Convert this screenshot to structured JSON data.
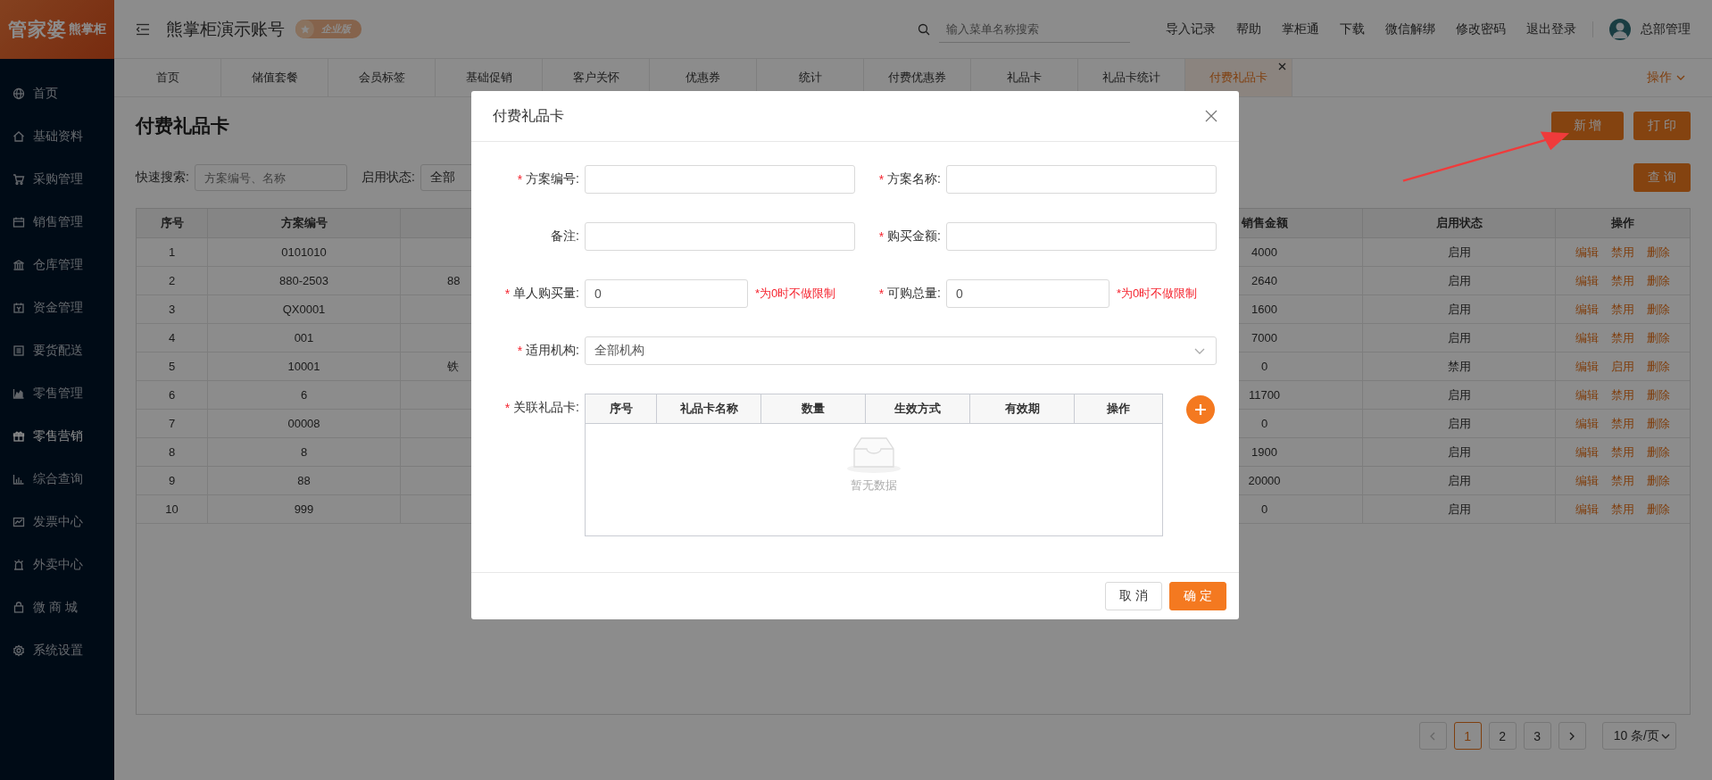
{
  "sidebar": {
    "logo": {
      "main": "管家婆",
      "sub": "熊掌柜"
    },
    "items": [
      {
        "label": "首页",
        "selected": false
      },
      {
        "label": "基础资料",
        "selected": false
      },
      {
        "label": "采购管理",
        "selected": false
      },
      {
        "label": "销售管理",
        "selected": false
      },
      {
        "label": "仓库管理",
        "selected": false
      },
      {
        "label": "资金管理",
        "selected": false
      },
      {
        "label": "要货配送",
        "selected": false
      },
      {
        "label": "零售管理",
        "selected": false
      },
      {
        "label": "零售营销",
        "selected": true
      },
      {
        "label": "综合查询",
        "selected": false
      },
      {
        "label": "发票中心",
        "selected": false
      },
      {
        "label": "外卖中心",
        "selected": false
      },
      {
        "label": "微 商 城",
        "selected": false
      },
      {
        "label": "系统设置",
        "selected": false
      }
    ]
  },
  "topbar": {
    "account": "熊掌柜演示账号",
    "badge": "企业版",
    "search": {
      "placeholder": "输入菜单名称搜索"
    },
    "links": [
      "导入记录",
      "帮助",
      "掌柜通",
      "下载",
      "微信解绑",
      "修改密码",
      "退出登录"
    ],
    "user": "总部管理"
  },
  "tabs": {
    "items": [
      {
        "label": "首页",
        "selected": false
      },
      {
        "label": "储值套餐",
        "selected": false
      },
      {
        "label": "会员标签",
        "selected": false
      },
      {
        "label": "基础促销",
        "selected": false
      },
      {
        "label": "客户关怀",
        "selected": false
      },
      {
        "label": "优惠券",
        "selected": false
      },
      {
        "label": "统计",
        "selected": false
      },
      {
        "label": "付费优惠券",
        "selected": false
      },
      {
        "label": "礼品卡",
        "selected": false
      },
      {
        "label": "礼品卡统计",
        "selected": false
      },
      {
        "label": "付费礼品卡",
        "selected": true
      }
    ],
    "menu": "操作"
  },
  "page": {
    "title": "付费礼品卡",
    "buttons": [
      "新 增",
      "打 印"
    ],
    "filters": {
      "search_label": "快速搜索:",
      "search_placeholder": "方案编号、名称",
      "status_label": "启用状态:",
      "status_value": "全部",
      "query_button": "查 询"
    }
  },
  "table": {
    "columns": [
      "序号",
      "方案编号",
      "销售金额",
      "启用状态",
      "操作"
    ],
    "rows": [
      {
        "seq": "1",
        "code": "0101010",
        "amount": "4000",
        "status": "启用",
        "actions": [
          "编辑",
          "禁用",
          "删除"
        ]
      },
      {
        "seq": "2",
        "code": "880-2503",
        "column_3": "88",
        "amount": "2640",
        "status": "启用",
        "actions": [
          "编辑",
          "禁用",
          "删除"
        ]
      },
      {
        "seq": "3",
        "code": "QX0001",
        "amount": "1600",
        "status": "启用",
        "actions": [
          "编辑",
          "禁用",
          "删除"
        ]
      },
      {
        "seq": "4",
        "code": "001",
        "amount": "7000",
        "status": "启用",
        "actions": [
          "编辑",
          "禁用",
          "删除"
        ]
      },
      {
        "seq": "5",
        "code": "10001",
        "column_3": "铁",
        "amount": "0",
        "status": "禁用",
        "actions": [
          "编辑",
          "启用",
          "删除"
        ]
      },
      {
        "seq": "6",
        "code": "6",
        "amount": "11700",
        "status": "启用",
        "actions": [
          "编辑",
          "禁用",
          "删除"
        ]
      },
      {
        "seq": "7",
        "code": "00008",
        "amount": "0",
        "status": "启用",
        "actions": [
          "编辑",
          "禁用",
          "删除"
        ]
      },
      {
        "seq": "8",
        "code": "8",
        "amount": "1900",
        "status": "启用",
        "actions": [
          "编辑",
          "禁用",
          "删除"
        ]
      },
      {
        "seq": "9",
        "code": "88",
        "amount": "20000",
        "status": "启用",
        "actions": [
          "编辑",
          "禁用",
          "删除"
        ]
      },
      {
        "seq": "10",
        "code": "999",
        "amount": "0",
        "status": "启用",
        "actions": [
          "编辑",
          "禁用",
          "删除"
        ]
      }
    ]
  },
  "pagination": {
    "pages": [
      {
        "label": "1",
        "selected": true
      },
      {
        "label": "2",
        "selected": false
      },
      {
        "label": "3",
        "selected": false
      }
    ],
    "page_size": "10 条/页"
  },
  "modal": {
    "title": "付费礼品卡",
    "fields": [
      {
        "label": "方案编号:",
        "mark": "*",
        "kind": "input"
      },
      {
        "label": "方案名称:",
        "mark": "*",
        "kind": "input"
      },
      {
        "label": "备注:",
        "kind": "input"
      },
      {
        "label": "购买金额:",
        "mark": "*",
        "kind": "input"
      },
      {
        "label": "单人购买量:",
        "mark": "*",
        "kind": "short",
        "value": "0",
        "hint": "*为0时不做限制"
      },
      {
        "label": "可购总量:",
        "mark": "*",
        "kind": "short",
        "value": "0",
        "hint": "*为0时不做限制"
      },
      {
        "label": "适用机构:",
        "mark": "*",
        "kind": "select",
        "value": "全部机构"
      }
    ],
    "linked": {
      "label": "关联礼品卡:",
      "mark": "*",
      "columns": [
        "序号",
        "礼品卡名称",
        "数量",
        "生效方式",
        "有效期",
        "操作"
      ],
      "empty_text": "暂无数据"
    },
    "buttons": [
      {
        "label": "取 消",
        "kind": "default"
      },
      {
        "label": "确 定",
        "kind": "primary"
      }
    ]
  }
}
